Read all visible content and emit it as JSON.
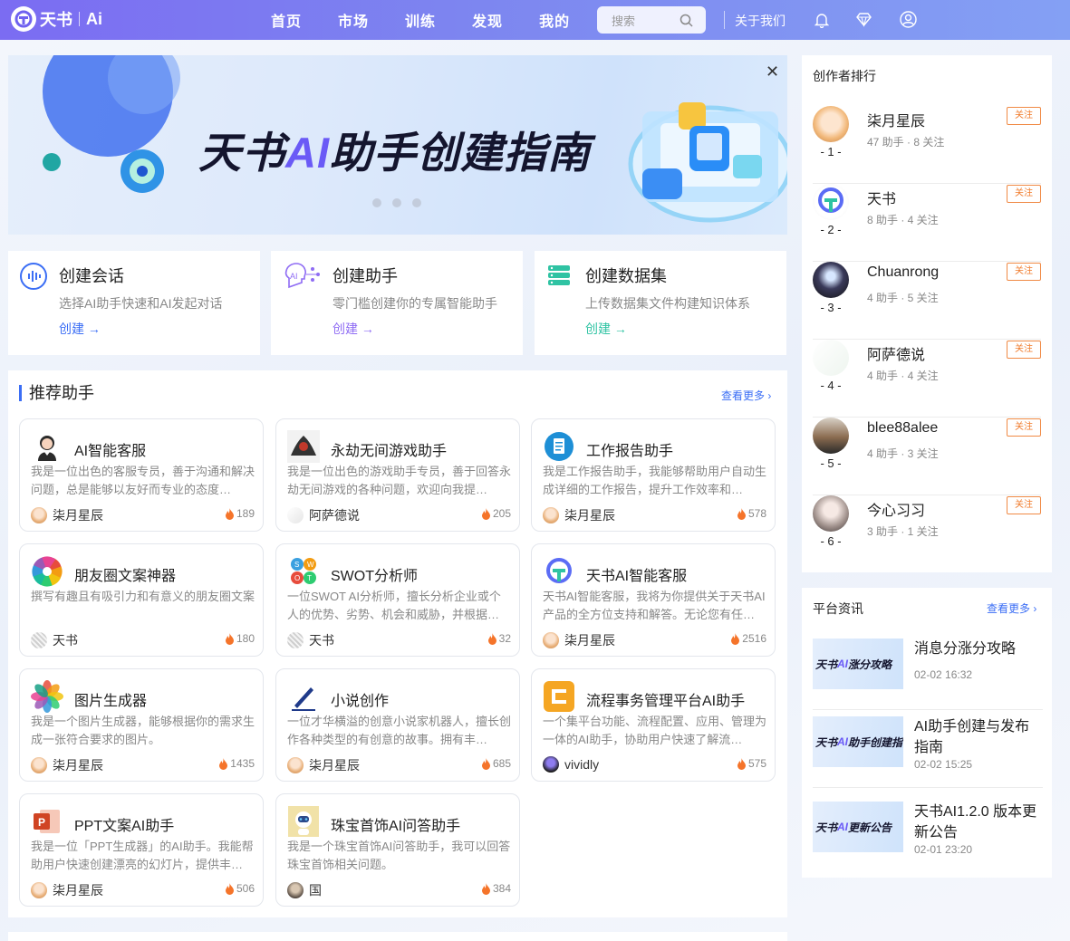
{
  "brand": {
    "name": "天书",
    "suffix": "Ai"
  },
  "nav": [
    "首页",
    "市场",
    "训练",
    "发现",
    "我的"
  ],
  "search": {
    "placeholder": "搜索"
  },
  "header": {
    "about": "关于我们"
  },
  "banner": {
    "title_a": "天书",
    "title_ai": "AI",
    "title_b": "助手创建指南"
  },
  "quick": [
    {
      "title": "创建会话",
      "desc": "选择AI助手快速和AI发起对话",
      "link": "创建",
      "color": "#3b6ef5",
      "icon": "voice-chat-icon"
    },
    {
      "title": "创建助手",
      "desc": "零门槛创建你的专属智能助手",
      "link": "创建",
      "color": "#8f6cf4",
      "icon": "ai-assistant-icon"
    },
    {
      "title": "创建数据集",
      "desc": "上传数据集文件构建知识体系",
      "link": "创建",
      "color": "#2fc3a3",
      "icon": "dataset-icon"
    }
  ],
  "recommend": {
    "title": "推荐助手",
    "more": "查看更多",
    "items": [
      {
        "name": "AI智能客服",
        "desc": "我是一位出色的客服专员，善于沟通和解决问题，总是能够以友好而专业的态度…",
        "author": "柒月星辰",
        "hot": "189",
        "icon": "customer-service-avatar-icon"
      },
      {
        "name": "永劫无间游戏助手",
        "desc": "我是一位出色的游戏助手专员，善于回答永劫无间游戏的各种问题，欢迎向我提…",
        "author": "阿萨德说",
        "hot": "205",
        "icon": "game-avatar-icon"
      },
      {
        "name": "工作报告助手",
        "desc": "我是工作报告助手，我能够帮助用户自动生成详细的工作报告，提升工作效率和…",
        "author": "柒月星辰",
        "hot": "578",
        "icon": "report-avatar-icon"
      },
      {
        "name": "朋友圈文案神器",
        "desc": "撰写有趣且有吸引力和有意义的朋友圈文案",
        "author": "天书",
        "hot": "180",
        "icon": "moments-avatar-icon"
      },
      {
        "name": "SWOT分析师",
        "desc": "一位SWOT AI分析师，擅长分析企业或个人的优势、劣势、机会和威胁，并根据…",
        "author": "天书",
        "hot": "32",
        "icon": "swot-avatar-icon"
      },
      {
        "name": "天书AI智能客服",
        "desc": "天书AI智能客服，我将为你提供关于天书AI产品的全方位支持和解答。无论您有任…",
        "author": "柒月星辰",
        "hot": "2516",
        "icon": "tianshu-avatar-icon"
      },
      {
        "name": "图片生成器",
        "desc": "我是一个图片生成器，能够根据你的需求生成一张符合要求的图片。",
        "author": "柒月星辰",
        "hot": "1435",
        "icon": "image-gen-avatar-icon"
      },
      {
        "name": "小说创作",
        "desc": "一位才华横溢的创意小说家机器人，擅长创作各种类型的有创意的故事。拥有丰…",
        "author": "柒月星辰",
        "hot": "685",
        "icon": "pen-avatar-icon"
      },
      {
        "name": "流程事务管理平台AI助手",
        "desc": "一个集平台功能、流程配置、应用、管理为一体的AI助手，协助用户快速了解流…",
        "author": "vividly",
        "hot": "575",
        "icon": "workflow-avatar-icon"
      },
      {
        "name": "PPT文案AI助手",
        "desc": "我是一位「PPT生成器」的AI助手。我能帮助用户快速创建漂亮的幻灯片，提供丰…",
        "author": "柒月星辰",
        "hot": "506",
        "icon": "ppt-avatar-icon"
      },
      {
        "name": "珠宝首饰AI问答助手",
        "desc": "我是一个珠宝首饰AI问答助手，我可以回答珠宝首饰相关问题。",
        "author": "国",
        "hot": "384",
        "icon": "robot-avatar-icon"
      }
    ]
  },
  "ranking": {
    "title": "创作者排行",
    "follow": "关注",
    "items": [
      {
        "no": "- 1 -",
        "name": "柒月星辰",
        "stats": "47 助手 · 8 关注"
      },
      {
        "no": "- 2 -",
        "name": "天书",
        "stats": "8 助手 · 4 关注"
      },
      {
        "no": "- 3 -",
        "name": "Chuanrong",
        "stats": "4 助手 · 5 关注"
      },
      {
        "no": "- 4 -",
        "name": "阿萨德说",
        "stats": "4 助手 · 4 关注"
      },
      {
        "no": "- 5 -",
        "name": "blee88alee",
        "stats": "4 助手 · 3 关注"
      },
      {
        "no": "- 6 -",
        "name": "今心习习",
        "stats": "3 助手 · 1 关注"
      }
    ]
  },
  "news": {
    "title": "平台资讯",
    "more": "查看更多",
    "items": [
      {
        "title": "消息分涨分攻略",
        "date": "02-02 16:32",
        "thumb_a": "天书",
        "thumb_ai": "AI",
        "thumb_b": "涨分攻略"
      },
      {
        "title": "AI助手创建与发布指南",
        "date": "02-02 15:25",
        "thumb_a": "天书",
        "thumb_ai": "AI",
        "thumb_b": "助手创建指南"
      },
      {
        "title": "天书AI1.2.0 版本更新公告",
        "date": "02-01 23:20",
        "thumb_a": "天书",
        "thumb_ai": "AI",
        "thumb_b": "更新公告"
      }
    ]
  }
}
